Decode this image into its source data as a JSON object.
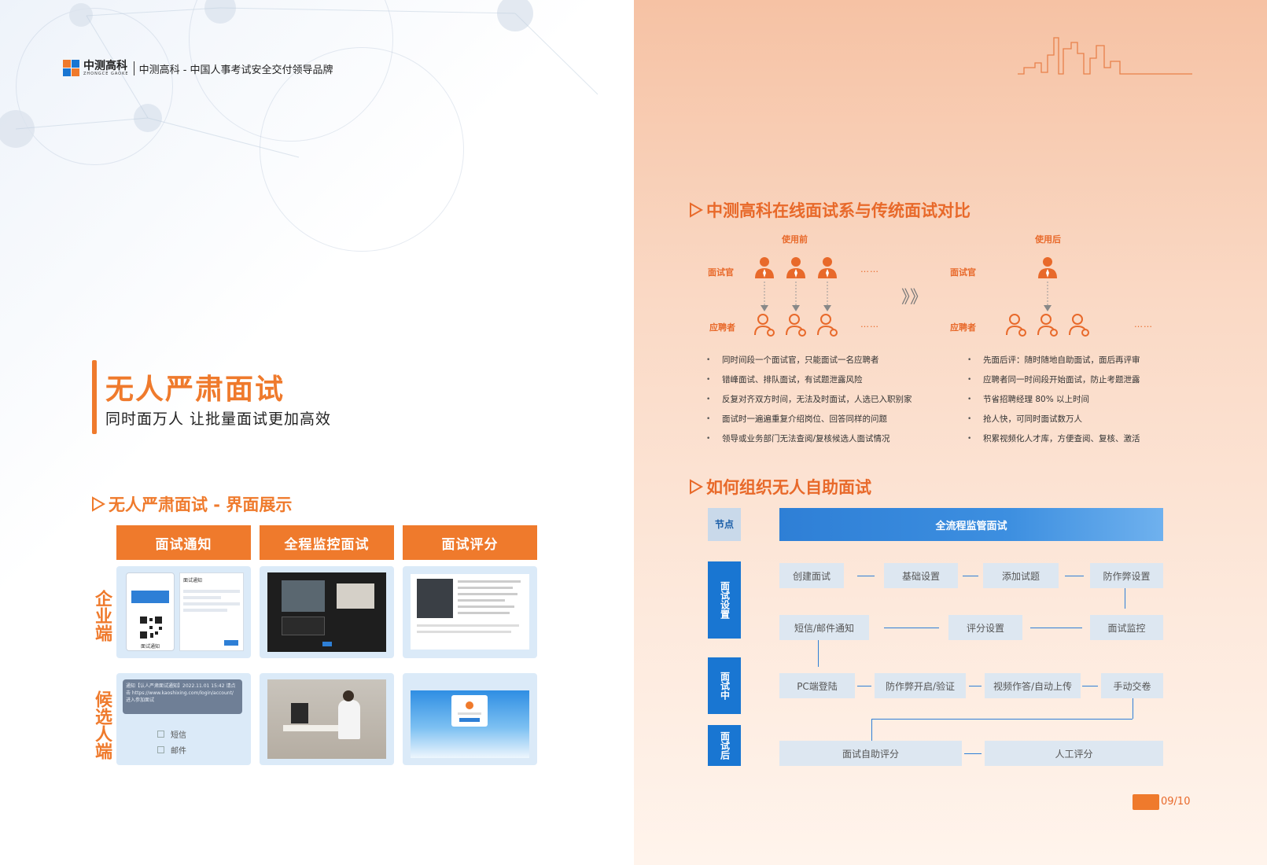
{
  "header": {
    "logo_name": "中测高科",
    "logo_sub": "ZHONGCE GAOKE",
    "tagline": "中测高科 - 中国人事考试安全交付领导品牌"
  },
  "left": {
    "title": "无人严肃面试",
    "subtitle": "同时面万人 让批量面试更加高效",
    "section_title": "无人严肃面试 - 界面展示",
    "columns": [
      "面试通知",
      "全程监控面试",
      "面试评分"
    ],
    "rows": [
      "企业端",
      "候选人端"
    ],
    "shot_sms": {
      "message": "通知【认人严肃面试通知】2022.11.01 15:42 请点击 https://www.kaoshixing.com/login/account/ 进入参加面试",
      "options": [
        "短信",
        "邮件"
      ]
    },
    "shot_qr_label": "面试通知",
    "shot_form_title": "面试通知"
  },
  "right": {
    "section1_title": "中测高科在线面试系与传统面试对比",
    "before_label": "使用前",
    "after_label": "使用后",
    "interviewer_label": "面试官",
    "candidate_label": "应聘者",
    "dots": "……",
    "before_points": [
      "同时间段一个面试官，只能面试一名应聘者",
      "错峰面试、排队面试，有试题泄露风险",
      "反复对齐双方时间，无法及时面试，人选已入职别家",
      "面试时一遍遍重复介绍岗位、回答同样的问题",
      "领导或业务部门无法查阅/复核候选人面试情况"
    ],
    "after_points": [
      "先面后评：随时随地自助面试，面后再评审",
      "应聘者同一时间段开始面试，防止考题泄露",
      "节省招聘经理 80% 以上时间",
      "抢人快，可同时面试数万人",
      "积累视频化人才库，方便查阅、复核、激活"
    ],
    "section2_title": "如何组织无人自助面试",
    "flow": {
      "node_label": "节点",
      "head": "全流程监管面试",
      "stage_setup": "面试设置",
      "stage_during": "面试中",
      "stage_after": "面试后",
      "row1": [
        "创建面试",
        "基础设置",
        "添加试题",
        "防作弊设置"
      ],
      "row2": [
        "短信/邮件通知",
        "评分设置",
        "面试监控"
      ],
      "row3": [
        "PC端登陆",
        "防作弊开启/验证",
        "视频作答/自动上传",
        "手动交卷"
      ],
      "row4": [
        "面试自助评分",
        "人工评分"
      ]
    },
    "page_number": "09/10"
  },
  "colors": {
    "accent": "#ef7a2c",
    "blue": "#1976d2",
    "box": "#dde7f1"
  }
}
